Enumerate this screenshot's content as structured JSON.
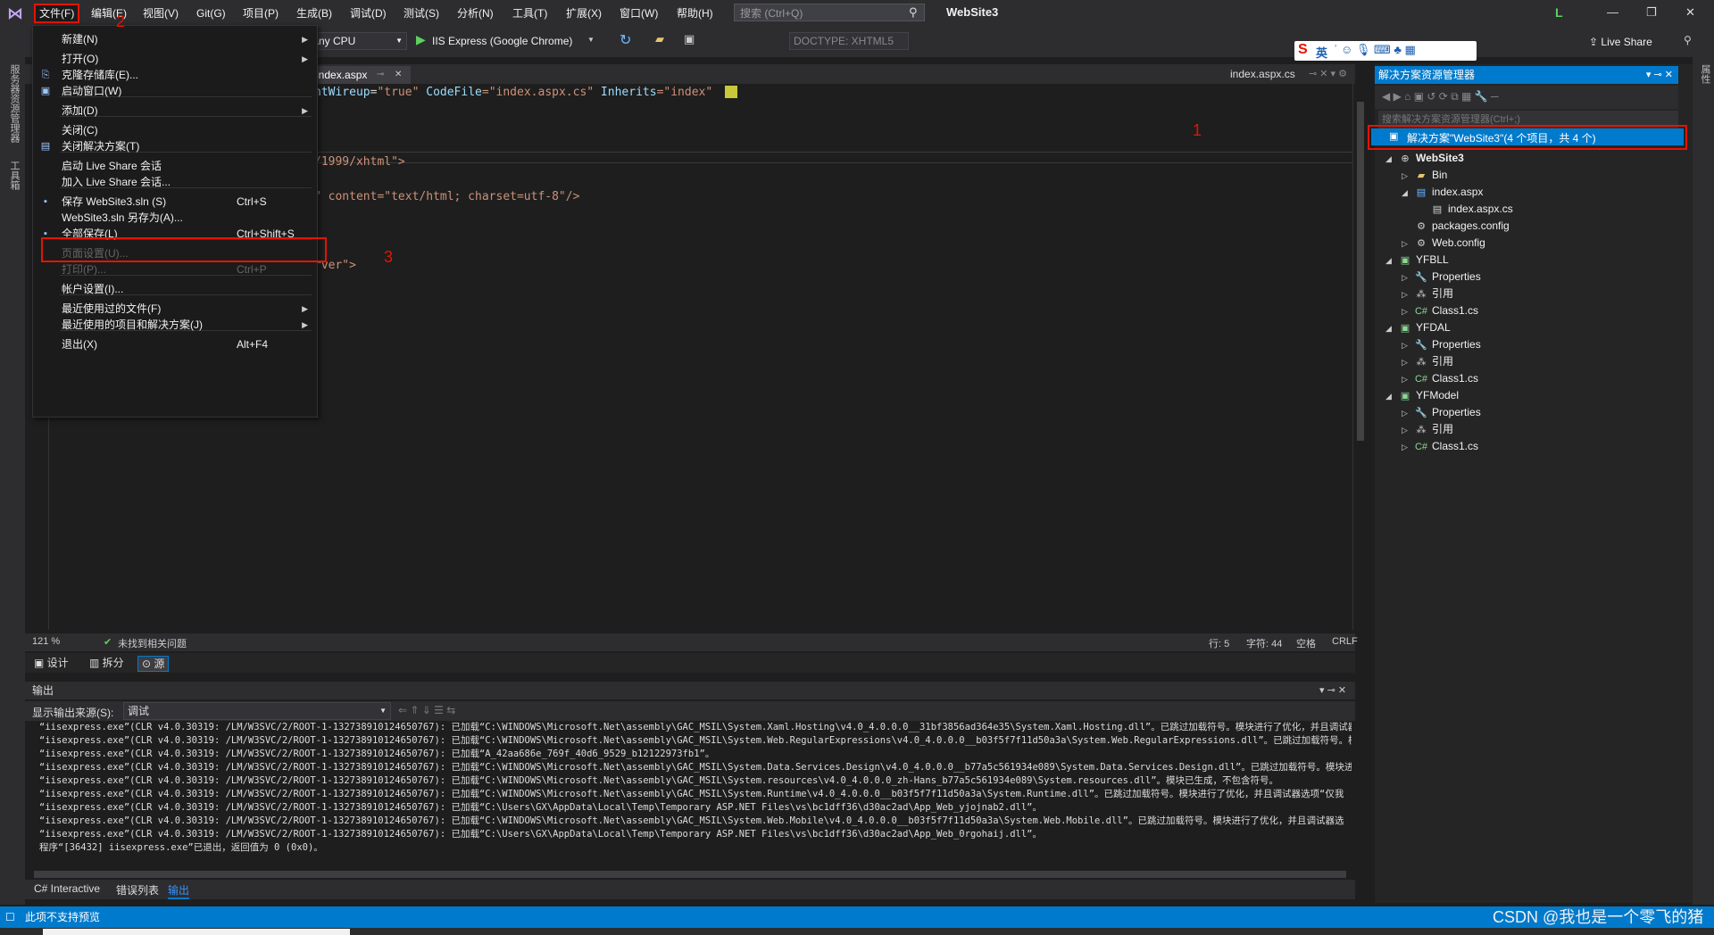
{
  "menubar": {
    "items": [
      "文件(F)",
      "编辑(E)",
      "视图(V)",
      "Git(G)",
      "项目(P)",
      "生成(B)",
      "调试(D)",
      "测试(S)",
      "分析(N)",
      "工具(T)",
      "扩展(X)",
      "窗口(W)",
      "帮助(H)"
    ],
    "search_placeholder": "搜索 (Ctrl+Q)",
    "solution_name": "WebSite3",
    "user_initial": "L"
  },
  "toolbar": {
    "platform": "Any CPU",
    "run_target": "IIS Express (Google Chrome)",
    "doctype": "DOCTYPE: XHTML5",
    "live_share": "Live Share",
    "ime": "英"
  },
  "left_strip": {
    "label_1": "服务器资源管理器",
    "label_2": "工具箱"
  },
  "editor": {
    "tab_active": "index.aspx",
    "tab_right": "index.aspx.cs",
    "zoom": "121 %",
    "issues": "未找到相关问题",
    "line": "行: 5",
    "char": "字符: 44",
    "whitespace": "空格",
    "eol": "CRLF",
    "code_lines": [
      {
        "attr": "ntWireup",
        "eq": "=",
        "val": "\"true\"",
        "rest1": " CodeFile",
        "val2": "=\"index.aspx.cs\"",
        "rest2": " Inherits",
        "val3": "=\"index\""
      },
      {
        "text": "/1999/xhtml\">"
      },
      {
        "text": "\" content=\"text/html; charset=utf-8\"/>"
      },
      {
        "text": "rver\">"
      }
    ]
  },
  "view_tabs": {
    "design": "设计",
    "split": "拆分",
    "source": "源"
  },
  "file_menu": {
    "items": [
      {
        "label": "新建(N)",
        "submenu": true
      },
      {
        "label": "打开(O)",
        "submenu": true
      },
      {
        "label": "克隆存储库(E)...",
        "icon": "clone-icon"
      },
      {
        "label": "启动窗口(W)",
        "icon": "start-window-icon"
      },
      {
        "label": "添加(D)",
        "submenu": true
      },
      {
        "label": "关闭(C)"
      },
      {
        "label": "关闭解决方案(T)",
        "icon": "close-solution-icon"
      },
      {
        "label": "启动 Live Share 会话"
      },
      {
        "label": "加入 Live Share 会话..."
      },
      {
        "label": "保存 WebSite3.sln (S)",
        "shortcut": "Ctrl+S",
        "icon": "save-icon"
      },
      {
        "label": "WebSite3.sln 另存为(A)..."
      },
      {
        "label": "全部保存(L)",
        "shortcut": "Ctrl+Shift+S",
        "icon": "save-all-icon"
      },
      {
        "label": "页面设置(U)...",
        "disabled": true
      },
      {
        "label": "打印(P)...",
        "shortcut": "Ctrl+P",
        "disabled": true
      },
      {
        "label": "帐户设置(I)..."
      },
      {
        "label": "最近使用过的文件(F)",
        "submenu": true
      },
      {
        "label": "最近使用的项目和解决方案(J)",
        "submenu": true
      },
      {
        "label": "退出(X)",
        "shortcut": "Alt+F4"
      }
    ]
  },
  "annotations": {
    "num_1": "1",
    "num_2": "2",
    "num_3": "3"
  },
  "solution_explorer": {
    "title": "解决方案资源管理器",
    "search_placeholder": "搜索解决方案资源管理器(Ctrl+;)",
    "root": "解决方案\"WebSite3\"(4 个项目，共 4 个)",
    "nodes": [
      {
        "label": "WebSite3",
        "bold": true
      },
      {
        "label": "Bin"
      },
      {
        "label": "index.aspx"
      },
      {
        "label": "index.aspx.cs"
      },
      {
        "label": "packages.config"
      },
      {
        "label": "Web.config"
      },
      {
        "label": "YFBLL"
      },
      {
        "label": "Properties"
      },
      {
        "label": "引用"
      },
      {
        "label": "Class1.cs"
      },
      {
        "label": "YFDAL"
      },
      {
        "label": "Properties"
      },
      {
        "label": "引用"
      },
      {
        "label": "Class1.cs"
      },
      {
        "label": "YFModel"
      },
      {
        "label": "Properties"
      },
      {
        "label": "引用"
      },
      {
        "label": "Class1.cs"
      }
    ]
  },
  "output": {
    "title": "输出",
    "source_label": "显示输出来源(S):",
    "source_value": "调试",
    "lines": [
      "“iisexpress.exe”(CLR v4.0.30319: /LM/W3SVC/2/ROOT-1-132738910124650767): 已加载“C:\\WINDOWS\\Microsoft.Net\\assembly\\GAC_MSIL\\System.Xaml.Hosting\\v4.0_4.0.0.0__31bf3856ad364e35\\System.Xaml.Hosting.dll”。已跳过加载符号。模块进行了优化，并且调试器",
      "“iisexpress.exe”(CLR v4.0.30319: /LM/W3SVC/2/ROOT-1-132738910124650767): 已加载“C:\\WINDOWS\\Microsoft.Net\\assembly\\GAC_MSIL\\System.Web.RegularExpressions\\v4.0_4.0.0.0__b03f5f7f11d50a3a\\System.Web.RegularExpressions.dll”。已跳过加载符号。模块进",
      "“iisexpress.exe”(CLR v4.0.30319: /LM/W3SVC/2/ROOT-1-132738910124650767): 已加载“A_42aa686e_769f_40d6_9529_b12122973fb1”。",
      "“iisexpress.exe”(CLR v4.0.30319: /LM/W3SVC/2/ROOT-1-132738910124650767): 已加载“C:\\WINDOWS\\Microsoft.Net\\assembly\\GAC_MSIL\\System.Data.Services.Design\\v4.0_4.0.0.0__b77a5c561934e089\\System.Data.Services.Design.dll”。已跳过加载符号。模块进行了",
      "“iisexpress.exe”(CLR v4.0.30319: /LM/W3SVC/2/ROOT-1-132738910124650767): 已加载“C:\\WINDOWS\\Microsoft.Net\\assembly\\GAC_MSIL\\System.resources\\v4.0_4.0.0.0_zh-Hans_b77a5c561934e089\\System.resources.dll”。模块已生成，不包含符号。",
      "“iisexpress.exe”(CLR v4.0.30319: /LM/W3SVC/2/ROOT-1-132738910124650767): 已加载“C:\\WINDOWS\\Microsoft.Net\\assembly\\GAC_MSIL\\System.Runtime\\v4.0_4.0.0.0__b03f5f7f11d50a3a\\System.Runtime.dll”。已跳过加载符号。模块进行了优化，并且调试器选项“仅我",
      "“iisexpress.exe”(CLR v4.0.30319: /LM/W3SVC/2/ROOT-1-132738910124650767): 已加载“C:\\Users\\GX\\AppData\\Local\\Temp\\Temporary ASP.NET Files\\vs\\bc1dff36\\d30ac2ad\\App_Web_yjojnab2.dll”。",
      "“iisexpress.exe”(CLR v4.0.30319: /LM/W3SVC/2/ROOT-1-132738910124650767): 已加载“C:\\WINDOWS\\Microsoft.Net\\assembly\\GAC_MSIL\\System.Web.Mobile\\v4.0_4.0.0.0__b03f5f7f11d50a3a\\System.Web.Mobile.dll”。已跳过加载符号。模块进行了优化，并且调试器选",
      "“iisexpress.exe”(CLR v4.0.30319: /LM/W3SVC/2/ROOT-1-132738910124650767): 已加载“C:\\Users\\GX\\AppData\\Local\\Temp\\Temporary ASP.NET Files\\vs\\bc1dff36\\d30ac2ad\\App_Web_0rgohaij.dll”。",
      "程序“[36432] iisexpress.exe”已退出，返回值为 0 (0x0)。"
    ]
  },
  "bottom_tabs": [
    "C# Interactive",
    "错误列表",
    "输出"
  ],
  "statusbar": {
    "text": "此项不支持预览"
  },
  "watermark": "CSDN @我也是一个零飞的猪",
  "colors": {
    "accent": "#007acc",
    "highlight": "#e51400",
    "menu_bg": "#1b1b1c"
  }
}
